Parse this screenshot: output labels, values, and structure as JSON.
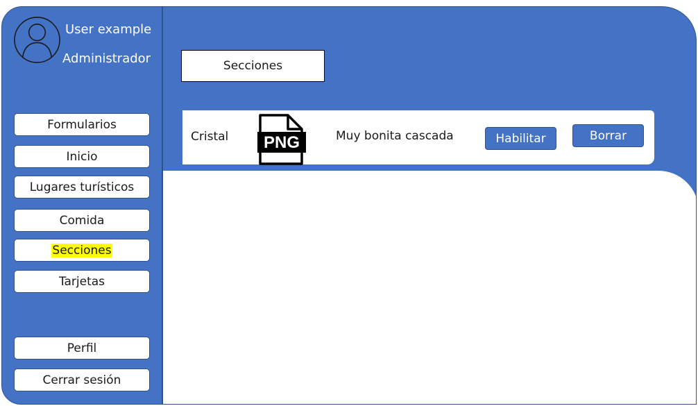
{
  "user": {
    "name": "User example",
    "role": "Administrador"
  },
  "sidebar": {
    "items": [
      {
        "label": "Formularios"
      },
      {
        "label": "Inicio"
      },
      {
        "label": "Lugares turísticos"
      },
      {
        "label": "Comida"
      },
      {
        "label": "Secciones",
        "active": true
      },
      {
        "label": "Tarjetas"
      }
    ],
    "profile_label": "Perfil",
    "logout_label": "Cerrar sesión"
  },
  "main": {
    "title": "Secciones",
    "rows": [
      {
        "name": "Cristal",
        "file_icon": "png-file-icon",
        "file_label": "PNG",
        "description": "Muy bonita cascada",
        "enable_label": "Habilitar",
        "delete_label": "Borrar"
      }
    ]
  },
  "colors": {
    "primary": "#4472c4",
    "border": "#2f528f",
    "highlight": "#ffff00",
    "surface": "#ffffff"
  }
}
